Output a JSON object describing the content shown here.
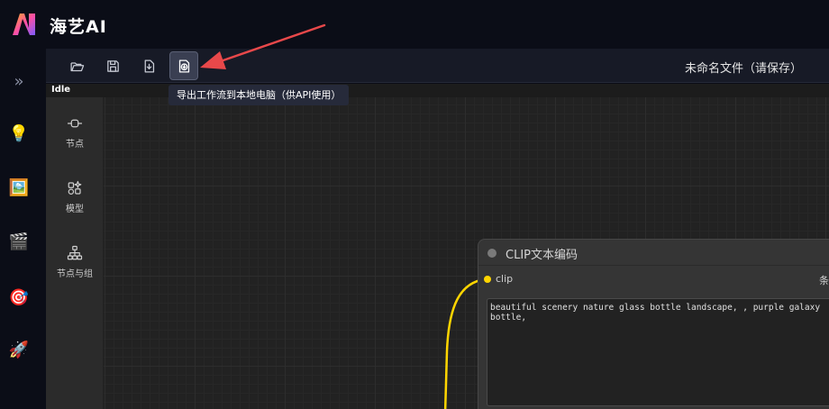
{
  "brand": {
    "name": "海艺AI"
  },
  "rail": {
    "items": [
      {
        "icon": "double-chevron-right-icon",
        "glyph": "»"
      },
      {
        "icon": "lightbulb-icon",
        "glyph": "💡"
      },
      {
        "icon": "picture-icon",
        "glyph": "🖼️"
      },
      {
        "icon": "clapper-board-icon",
        "glyph": "🎬"
      },
      {
        "icon": "target-icon",
        "glyph": "🎯"
      },
      {
        "icon": "rocket-icon",
        "glyph": "🚀"
      }
    ]
  },
  "toolbar": {
    "buttons": [
      {
        "icon": "open-folder-icon"
      },
      {
        "icon": "save-icon"
      },
      {
        "icon": "export-icon"
      },
      {
        "icon": "export-api-icon",
        "active": true
      }
    ],
    "file_title": "未命名文件（请保存）",
    "tooltip": "导出工作流到本地电脑（供API使用）"
  },
  "status": {
    "label": "Idle"
  },
  "panel": {
    "items": [
      {
        "icon": "node-icon",
        "label": "节点"
      },
      {
        "icon": "model-icon",
        "label": "模型"
      },
      {
        "icon": "node-group-icon",
        "label": "节点与组"
      }
    ]
  },
  "node": {
    "title": "CLIP文本编码",
    "input_slot": "clip",
    "output_slot": "条",
    "text": "beautiful scenery nature glass bottle landscape, , purple galaxy\nbottle,"
  },
  "colors": {
    "accent": "#ffd500",
    "arrow": "#e8484a",
    "canvas": "#222222",
    "toolbar": "#171a26"
  }
}
